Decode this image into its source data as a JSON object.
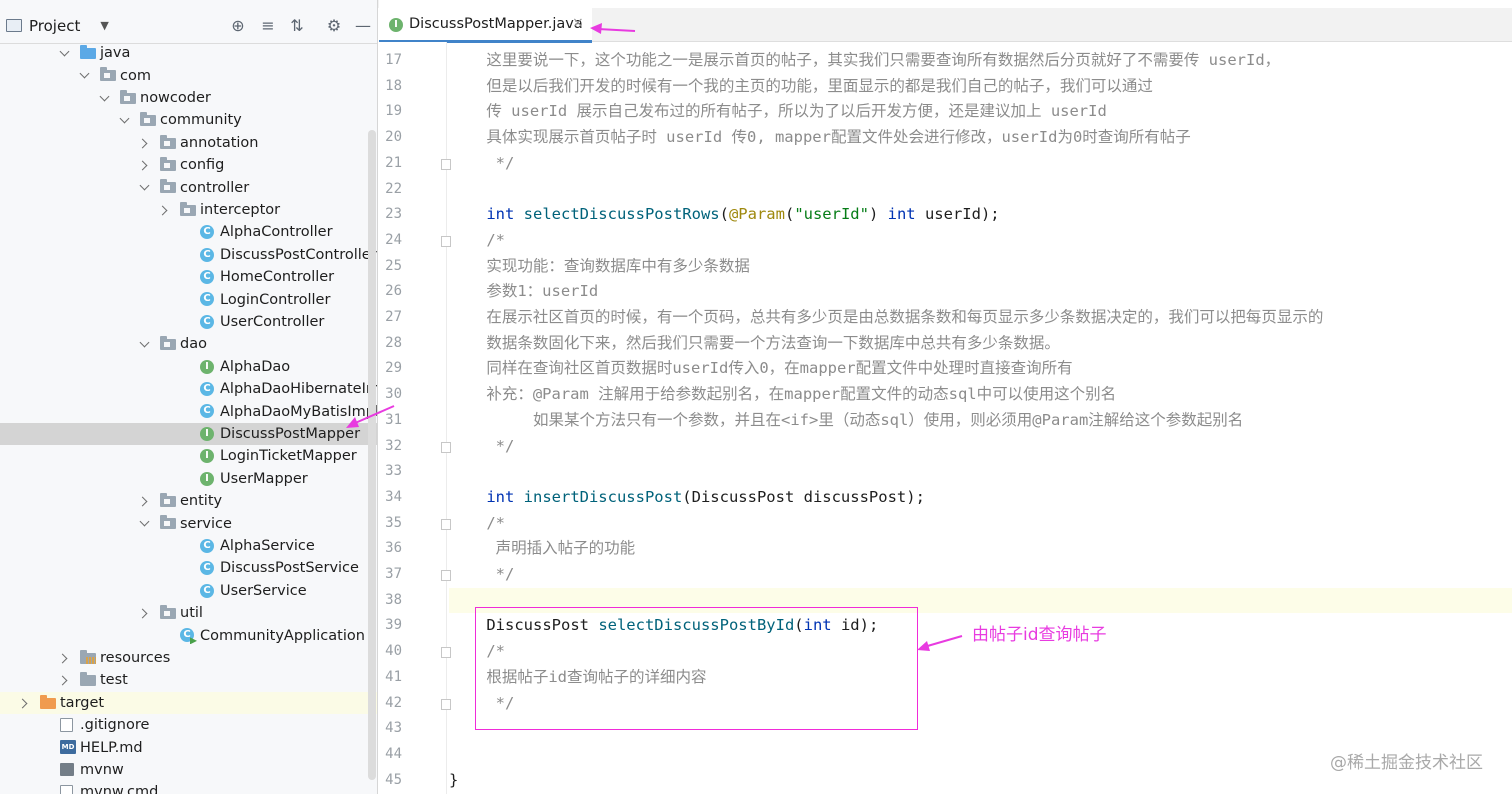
{
  "project_panel": {
    "title": "Project",
    "tree": [
      {
        "label": "java",
        "indent": 2,
        "arrow": "open",
        "icon": "folder-blue"
      },
      {
        "label": "com",
        "indent": 3,
        "arrow": "open",
        "icon": "package"
      },
      {
        "label": "nowcoder",
        "indent": 4,
        "arrow": "open",
        "icon": "package"
      },
      {
        "label": "community",
        "indent": 5,
        "arrow": "open",
        "icon": "package"
      },
      {
        "label": "annotation",
        "indent": 6,
        "arrow": "closed",
        "icon": "package"
      },
      {
        "label": "config",
        "indent": 6,
        "arrow": "closed",
        "icon": "package"
      },
      {
        "label": "controller",
        "indent": 6,
        "arrow": "open",
        "icon": "package"
      },
      {
        "label": "interceptor",
        "indent": 7,
        "arrow": "closed",
        "icon": "package"
      },
      {
        "label": "AlphaController",
        "indent": 8,
        "arrow": "none",
        "icon": "class"
      },
      {
        "label": "DiscussPostController",
        "indent": 8,
        "arrow": "none",
        "icon": "class"
      },
      {
        "label": "HomeController",
        "indent": 8,
        "arrow": "none",
        "icon": "class"
      },
      {
        "label": "LoginController",
        "indent": 8,
        "arrow": "none",
        "icon": "class"
      },
      {
        "label": "UserController",
        "indent": 8,
        "arrow": "none",
        "icon": "class"
      },
      {
        "label": "dao",
        "indent": 6,
        "arrow": "open",
        "icon": "package"
      },
      {
        "label": "AlphaDao",
        "indent": 8,
        "arrow": "none",
        "icon": "interface"
      },
      {
        "label": "AlphaDaoHibernateImpl",
        "indent": 8,
        "arrow": "none",
        "icon": "class"
      },
      {
        "label": "AlphaDaoMyBatisImpl",
        "indent": 8,
        "arrow": "none",
        "icon": "class"
      },
      {
        "label": "DiscussPostMapper",
        "indent": 8,
        "arrow": "none",
        "icon": "interface",
        "selected": true
      },
      {
        "label": "LoginTicketMapper",
        "indent": 8,
        "arrow": "none",
        "icon": "interface"
      },
      {
        "label": "UserMapper",
        "indent": 8,
        "arrow": "none",
        "icon": "interface"
      },
      {
        "label": "entity",
        "indent": 6,
        "arrow": "closed",
        "icon": "package"
      },
      {
        "label": "service",
        "indent": 6,
        "arrow": "open",
        "icon": "package"
      },
      {
        "label": "AlphaService",
        "indent": 8,
        "arrow": "none",
        "icon": "class"
      },
      {
        "label": "DiscussPostService",
        "indent": 8,
        "arrow": "none",
        "icon": "class"
      },
      {
        "label": "UserService",
        "indent": 8,
        "arrow": "none",
        "icon": "class"
      },
      {
        "label": "util",
        "indent": 6,
        "arrow": "closed",
        "icon": "package"
      },
      {
        "label": "CommunityApplication",
        "indent": 7,
        "arrow": "none",
        "icon": "app"
      },
      {
        "label": "resources",
        "indent": 2,
        "arrow": "closed",
        "icon": "resources"
      },
      {
        "label": "test",
        "indent": 2,
        "arrow": "closed",
        "icon": "folder"
      },
      {
        "label": "target",
        "indent": 0,
        "arrow": "closed",
        "icon": "folder-orange",
        "highlight": true
      },
      {
        "label": ".gitignore",
        "indent": 1,
        "arrow": "none",
        "icon": "file"
      },
      {
        "label": "HELP.md",
        "indent": 1,
        "arrow": "none",
        "icon": "md"
      },
      {
        "label": "mvnw",
        "indent": 1,
        "arrow": "none",
        "icon": "terminal"
      },
      {
        "label": "mvnw.cmd",
        "indent": 1,
        "arrow": "none",
        "icon": "file"
      }
    ]
  },
  "editor": {
    "tab_label": "DiscussPostMapper.java",
    "first_line_number": 17,
    "lines": [
      [
        [
          "cm",
          "    这里要说一下，这个功能之一是展示首页的帖子，其实我们只需要查询所有数据然后分页就好了不需要传 userId，"
        ]
      ],
      [
        [
          "cm",
          "    但是以后我们开发的时候有一个我的主页的功能，里面显示的都是我们自己的帖子，我们可以通过"
        ]
      ],
      [
        [
          "cm",
          "    传 userId 展示自己发布过的所有帖子，所以为了以后开发方便，还是建议加上 userId"
        ]
      ],
      [
        [
          "cm",
          "    具体实现展示首页帖子时 userId 传0, mapper配置文件处会进行修改，userId为0时查询所有帖子"
        ]
      ],
      [
        [
          "cm",
          "     */"
        ]
      ],
      [],
      [
        [
          "kw",
          "    int "
        ],
        [
          "fn",
          "selectDiscussPostRows"
        ],
        [
          "id",
          "("
        ],
        [
          "an",
          "@Param"
        ],
        [
          "id",
          "("
        ],
        [
          "st",
          "\"userId\""
        ],
        [
          "id",
          ") "
        ],
        [
          "kw",
          "int "
        ],
        [
          "id",
          "userId);"
        ]
      ],
      [
        [
          "cm",
          "    /*"
        ]
      ],
      [
        [
          "cm",
          "    实现功能：查询数据库中有多少条数据"
        ]
      ],
      [
        [
          "cm",
          "    参数1：userId"
        ]
      ],
      [
        [
          "cm",
          "    在展示社区首页的时候，有一个页码，总共有多少页是由总数据条数和每页显示多少条数据决定的，我们可以把每页显示的"
        ]
      ],
      [
        [
          "cm",
          "    数据条数固化下来，然后我们只需要一个方法查询一下数据库中总共有多少条数据。"
        ]
      ],
      [
        [
          "cm",
          "    同样在查询社区首页数据时userId传入0，在mapper配置文件中处理时直接查询所有"
        ]
      ],
      [
        [
          "cm",
          "    补充：@Param 注解用于给参数起别名，在mapper配置文件的动态sql中可以使用这个别名"
        ]
      ],
      [
        [
          "cm",
          "         如果某个方法只有一个参数，并且在<if>里（动态sql）使用，则必须用@Param注解给这个参数起别名"
        ]
      ],
      [
        [
          "cm",
          "     */"
        ]
      ],
      [],
      [
        [
          "kw",
          "    int "
        ],
        [
          "fn",
          "insertDiscussPost"
        ],
        [
          "id",
          "(DiscussPost discussPost);"
        ]
      ],
      [
        [
          "cm",
          "    /*"
        ]
      ],
      [
        [
          "cm",
          "     声明插入帖子的功能"
        ]
      ],
      [
        [
          "cm",
          "     */"
        ]
      ],
      [],
      [
        [
          "id",
          "    DiscussPost "
        ],
        [
          "m",
          "selectDiscussPostById"
        ],
        [
          "id",
          "("
        ],
        [
          "kw",
          "int "
        ],
        [
          "id",
          "id);"
        ]
      ],
      [
        [
          "cm",
          "    /*"
        ]
      ],
      [
        [
          "cm",
          "    根据帖子id查询帖子的详细内容"
        ]
      ],
      [
        [
          "cm",
          "     */"
        ]
      ],
      [],
      [],
      [
        [
          "id",
          "}"
        ]
      ]
    ],
    "current_line_number": 38,
    "fold_marker_lines": [
      21,
      24,
      32,
      35,
      37,
      40,
      42
    ]
  },
  "annotation": {
    "note": "由帖子id查询帖子",
    "color": "#e83be0"
  },
  "watermark": "@稀土掘金技术社区"
}
